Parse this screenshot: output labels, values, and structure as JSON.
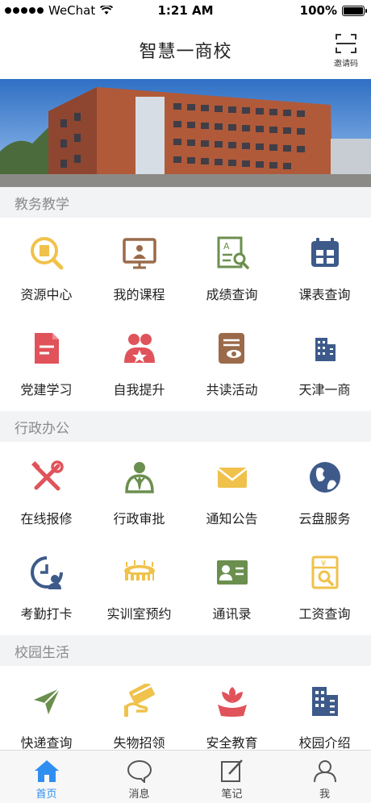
{
  "status_bar": {
    "carrier": "WeChat",
    "time": "1:21 AM",
    "battery": "100%"
  },
  "nav": {
    "title": "智慧一商校",
    "invite_label": "邀请码"
  },
  "sections": [
    {
      "title": "教务教学",
      "items": [
        {
          "label": "资源中心",
          "icon": "resource-center-icon",
          "color": "#f0c24b"
        },
        {
          "label": "我的课程",
          "icon": "my-courses-icon",
          "color": "#9a6a4a"
        },
        {
          "label": "成绩查询",
          "icon": "grade-query-icon",
          "color": "#6b8f4e"
        },
        {
          "label": "课表查询",
          "icon": "schedule-query-icon",
          "color": "#3d5a8a"
        },
        {
          "label": "党建学习",
          "icon": "party-study-icon",
          "color": "#e0535a"
        },
        {
          "label": "自我提升",
          "icon": "self-improve-icon",
          "color": "#e0535a"
        },
        {
          "label": "共读活动",
          "icon": "reading-activity-icon",
          "color": "#9a6a4a"
        },
        {
          "label": "天津一商",
          "icon": "tianjin-school-icon",
          "color": "#3d5a8a"
        }
      ]
    },
    {
      "title": "行政办公",
      "items": [
        {
          "label": "在线报修",
          "icon": "repair-icon",
          "color": "#e0535a"
        },
        {
          "label": "行政审批",
          "icon": "approval-icon",
          "color": "#6b8f4e"
        },
        {
          "label": "通知公告",
          "icon": "notice-icon",
          "color": "#f0c24b"
        },
        {
          "label": "云盘服务",
          "icon": "cloud-disk-icon",
          "color": "#3d5a8a"
        },
        {
          "label": "考勤打卡",
          "icon": "attendance-icon",
          "color": "#3d5a8a"
        },
        {
          "label": "实训室预约",
          "icon": "lab-booking-icon",
          "color": "#f0c24b"
        },
        {
          "label": "通讯录",
          "icon": "contacts-icon",
          "color": "#6b8f4e"
        },
        {
          "label": "工资查询",
          "icon": "salary-query-icon",
          "color": "#f0c24b"
        }
      ]
    },
    {
      "title": "校园生活",
      "items": [
        {
          "label": "快递查询",
          "icon": "express-query-icon",
          "color": "#6b8f4e"
        },
        {
          "label": "失物招领",
          "icon": "lost-found-icon",
          "color": "#f0c24b"
        },
        {
          "label": "安全教育",
          "icon": "safety-education-icon",
          "color": "#e0535a"
        },
        {
          "label": "校园介绍",
          "icon": "campus-intro-icon",
          "color": "#3d5a8a"
        }
      ]
    }
  ],
  "tabs": [
    {
      "label": "首页",
      "icon": "home-icon",
      "active": true
    },
    {
      "label": "消息",
      "icon": "message-icon",
      "active": false
    },
    {
      "label": "笔记",
      "icon": "note-icon",
      "active": false
    },
    {
      "label": "我",
      "icon": "profile-icon",
      "active": false
    }
  ],
  "colors": {
    "accent": "#2f8ff0",
    "section_bg": "#f2f3f5",
    "yellow": "#f0c24b",
    "brown": "#9a6a4a",
    "green": "#6b8f4e",
    "navy": "#3d5a8a",
    "red": "#e0535a"
  }
}
